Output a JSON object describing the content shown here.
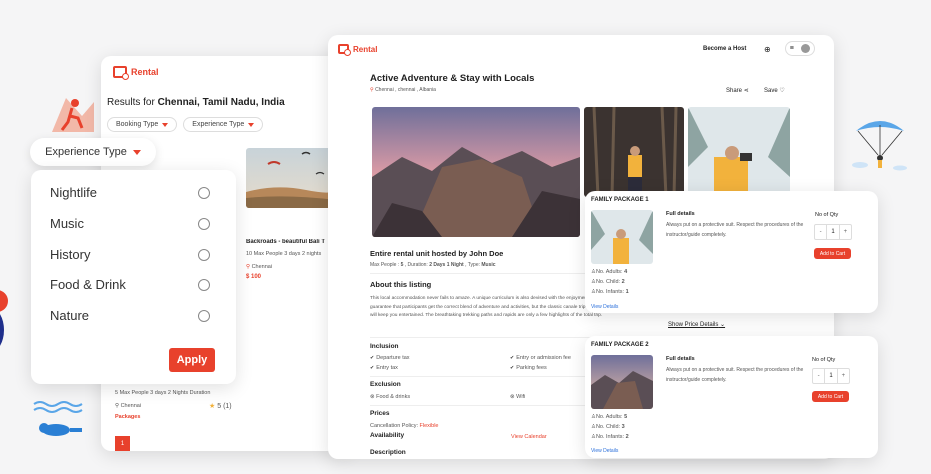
{
  "brand": "Rental",
  "results": {
    "title_prefix": "Results for ",
    "title_place": "Chennai, Tamil Nadu, India",
    "filter_booking": "Booking Type",
    "filter_experience": "Experience Type",
    "card1_title": "Backroads - beautiful Bali T",
    "card1_meta": "10 Max People  3 days 2 nights",
    "card1_loc": "Chennai",
    "card1_price": "$ 100",
    "card2_meta": "5 Max People  3 days 2 Nights Duration",
    "card2_loc": "Chennai",
    "card2_rating": "5 (1)",
    "card2_tag": "Packages",
    "page_num": "1"
  },
  "experience": {
    "label": "Experience Type",
    "options": [
      "Nightlife",
      "Music",
      "History",
      "Food & Drink",
      "Nature"
    ],
    "apply": "Apply"
  },
  "detail": {
    "nav_host": "Become a Host",
    "title": "Active Adventure & Stay with Locals",
    "location": "Chennai , chennai , Albania",
    "share": "Share",
    "save": "Save",
    "host_line": "Entire rental unit hosted by John Doe",
    "meta_label1": "Max People : ",
    "meta_val1": "5",
    "meta_label2": " , Duration: ",
    "meta_val2": "2 Days 1 Night",
    "meta_label3": " , Type: ",
    "meta_val3": "Music",
    "about_title": "About this listing",
    "about_text": "This local accommodation never fails to amaze. A unique curriculum is also devised with the enjoyment to guarantee that participants get the correct blend of adventure and activities, but the classic canale trip and boats will keep you entertained. The breathtaking trekking paths and rapids are only a few highlights of the total trip.",
    "inclusion_title": "Inclusion",
    "inclusion": [
      "Departure tax",
      "Entry or admission fee",
      "Entry tax",
      "Parking fees"
    ],
    "exclusion_title": "Exclusion",
    "exclusion": [
      "Food & drinks",
      "Wifi"
    ],
    "prices_title": "Prices",
    "cancel_label": "Cancellation Policy: ",
    "cancel_val": "Flexible",
    "availability": "Availability",
    "view_calendar": "View Calendar",
    "description": "Description",
    "show_price": "Show Price Details"
  },
  "packages": [
    {
      "title": "FAMILY PACKAGE 1",
      "full_details": "Full details",
      "desc": "Always put on a protective suit. Respect the procedures of the instructor/guide completely.",
      "qty_label": "No of Qty",
      "qty": "1",
      "minus": "-",
      "plus": "+",
      "add": "Add to Cart",
      "adults_label": "No. Adults: ",
      "adults": "4",
      "child_label": "No. Child: ",
      "child": "2",
      "infants_label": "No. Infants: ",
      "infants": "1",
      "view": "View Details"
    },
    {
      "title": "FAMILY PACKAGE 2",
      "full_details": "Full details",
      "desc": "Always put on a protective suit. Respect the procedures of the instructor/guide completely.",
      "qty_label": "No of Qty",
      "qty": "1",
      "minus": "-",
      "plus": "+",
      "add": "Add to Cart",
      "adults_label": "No. Adults: ",
      "adults": "5",
      "child_label": "No. Child: ",
      "child": "3",
      "infants_label": "No. Infants: ",
      "infants": "2",
      "view": "View Details"
    }
  ],
  "colors": {
    "accent": "#e8412c",
    "link": "#2a6fdb"
  }
}
